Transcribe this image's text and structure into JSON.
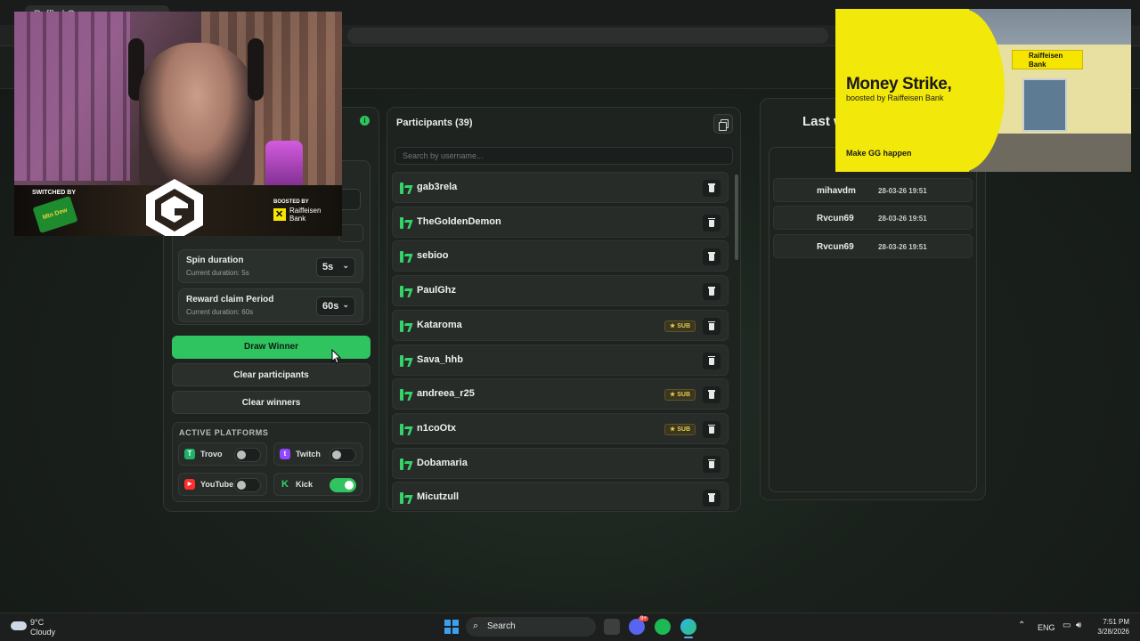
{
  "browser": {
    "tab_title": "Raffle | G..."
  },
  "settings": {
    "rows": [
      {
        "title": "Spin duration",
        "subtitle": "Current duration: 5s",
        "value": "5s"
      },
      {
        "title": "Reward claim Period",
        "subtitle": "Current duration: 60s",
        "value": "60s"
      }
    ],
    "draw_label": "Draw Winner",
    "clear_participants_label": "Clear participants",
    "clear_winners_label": "Clear winners",
    "platforms_title": "ACTIVE PLATFORMS",
    "platforms": [
      {
        "name": "Trovo",
        "enabled": false,
        "color": "#1fb36a",
        "icon": "trovo-icon"
      },
      {
        "name": "Twitch",
        "enabled": false,
        "color": "#9146ff",
        "icon": "twitch-icon"
      },
      {
        "name": "YouTube",
        "enabled": false,
        "color": "#ff2d2d",
        "icon": "youtube-icon"
      },
      {
        "name": "Kick",
        "enabled": true,
        "color": "#35d46a",
        "icon": "kick-icon"
      }
    ]
  },
  "participants": {
    "title": "Participants (39)",
    "search_placeholder": "Search by username...",
    "items": [
      {
        "name": "gab3rela",
        "sub": false
      },
      {
        "name": "TheGoldenDemon",
        "sub": false
      },
      {
        "name": "sebioo",
        "sub": false
      },
      {
        "name": "PaulGhz",
        "sub": false
      },
      {
        "name": "Kataroma",
        "sub": true
      },
      {
        "name": "Sava_hhb",
        "sub": false
      },
      {
        "name": "andreea_r25",
        "sub": true
      },
      {
        "name": "n1coOtx",
        "sub": true
      },
      {
        "name": "Dobamaria",
        "sub": false
      },
      {
        "name": "Micutzull",
        "sub": false
      }
    ],
    "sub_label": "SUB"
  },
  "winners": {
    "title": "Last w",
    "items": [
      {
        "name": "mihavdm",
        "date": "28-03-26 19:51"
      },
      {
        "name": "Rvcun69",
        "date": "28-03-26 19:51"
      },
      {
        "name": "Rvcun69",
        "date": "28-03-26 19:51"
      }
    ]
  },
  "webcam": {
    "switched_by": "SWITCHED BY",
    "dew_text": "Mtn Dew",
    "boosted_by": "BOOSTED BY",
    "bank_name": "Raiffeisen\nBank"
  },
  "ad": {
    "headline": "Money Strike,",
    "subline": "boosted by Raiffeisen Bank",
    "tagline": "Make GG happen",
    "sign_text": "Raiffeisen Bank"
  },
  "taskbar": {
    "weather_temp": "9°C",
    "weather_desc": "Cloudy",
    "search_label": "Search",
    "language": "ENG",
    "time": "7:51 PM",
    "date": "3/28/2026",
    "discord_badge": "9+"
  }
}
